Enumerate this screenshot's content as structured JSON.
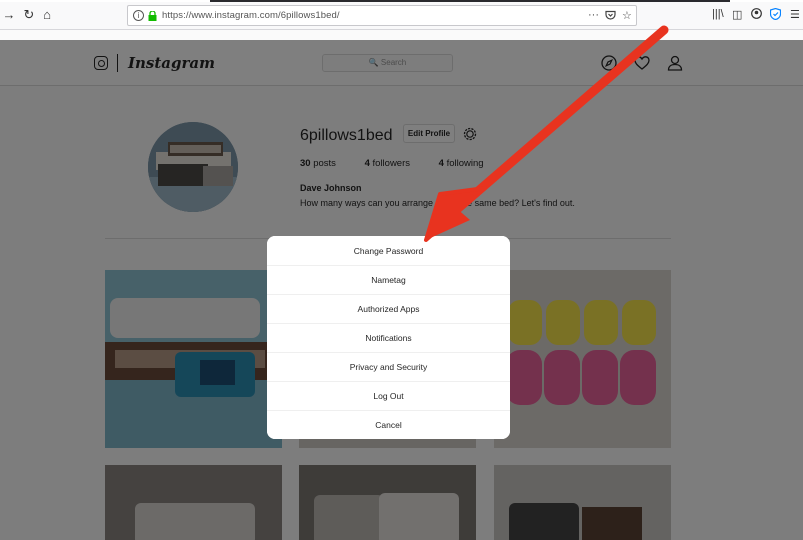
{
  "browser": {
    "url": "https://www.instagram.com/6pillows1bed/"
  },
  "header": {
    "wordmark": "Instagram",
    "search_placeholder": "Search"
  },
  "profile": {
    "username": "6pillows1bed",
    "edit_label": "Edit Profile",
    "posts": "30",
    "posts_label": "posts",
    "followers": "4",
    "followers_label": "followers",
    "following": "4",
    "following_label": "following",
    "full_name": "Dave Johnson",
    "bio": "How many ways can you arrange … on the same bed? Let's find out."
  },
  "modal": {
    "items": [
      {
        "label": "Change Password"
      },
      {
        "label": "Nametag"
      },
      {
        "label": "Authorized Apps"
      },
      {
        "label": "Notifications"
      },
      {
        "label": "Privacy and Security"
      },
      {
        "label": "Log Out"
      },
      {
        "label": "Cancel"
      }
    ]
  },
  "colors": {
    "annotation_arrow": "#e8331f",
    "overlay": "rgba(0,0,0,0.5)"
  }
}
